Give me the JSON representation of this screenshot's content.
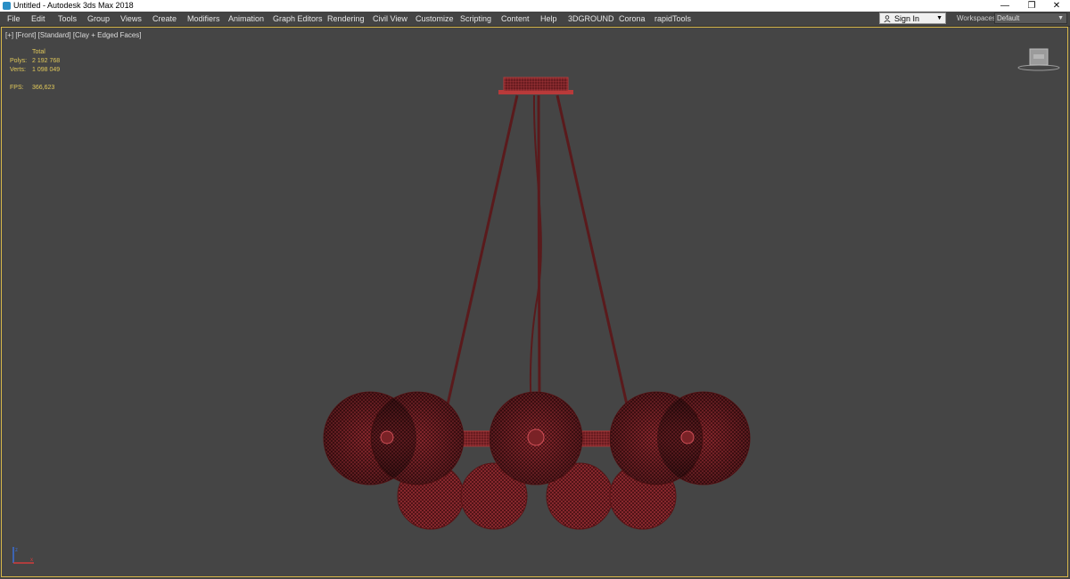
{
  "window": {
    "title": "Untitled - Autodesk 3ds Max 2018",
    "minimize": "—",
    "restore": "❐",
    "close": "✕"
  },
  "menu": [
    "File",
    "Edit",
    "Tools",
    "Group",
    "Views",
    "Create",
    "Modifiers",
    "Animation",
    "Graph Editors",
    "Rendering",
    "Civil View",
    "Customize",
    "Scripting",
    "Content",
    "Help",
    "3DGROUND",
    "Corona",
    "rapidTools"
  ],
  "account": {
    "sign_in": "Sign In"
  },
  "workspaces": {
    "label": "Workspaces:",
    "value": "Default"
  },
  "viewport": {
    "label": "[+] [Front] [Standard] [Clay + Edged Faces]",
    "stats": {
      "header": "Total",
      "polys_label": "Polys:",
      "polys": "2 192 768",
      "verts_label": "Verts:",
      "verts": "1 098 049",
      "fps_label": "FPS:",
      "fps": "366,623"
    }
  },
  "colors": {
    "wire": "#b83a3a",
    "sphere_fill": "#4a1014",
    "viewport_bg": "#454545",
    "viewport_border": "#d8b84a",
    "stats_text": "#e0c85a"
  },
  "icons": {
    "app": "3dsmax-icon",
    "user": "user-icon",
    "viewcube": "viewcube-icon",
    "axis": "axis-tripod-icon"
  }
}
